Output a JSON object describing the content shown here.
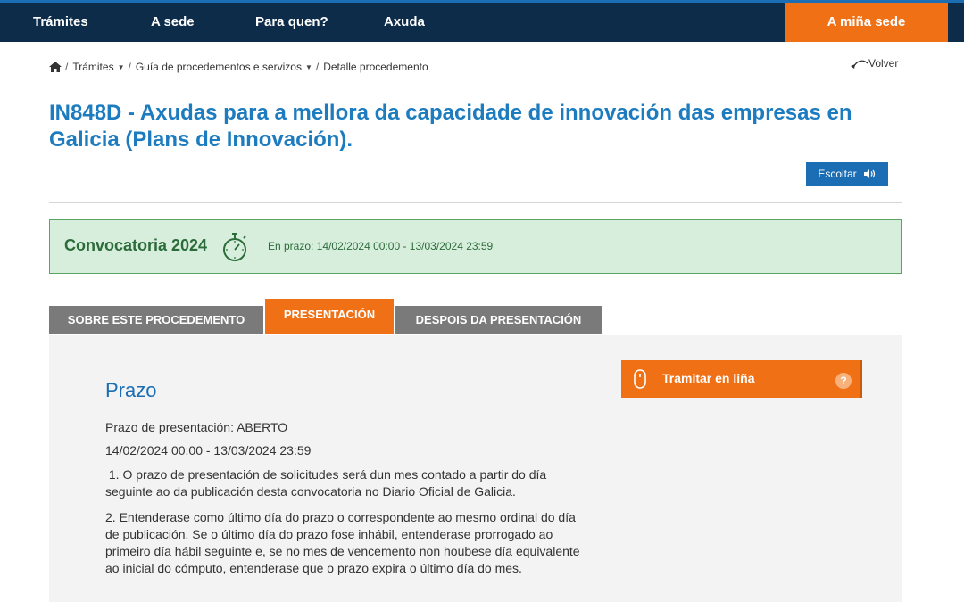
{
  "nav": {
    "items": [
      "Trámites",
      "A sede",
      "Para quen?",
      "Axuda"
    ],
    "my_site": "A miña sede"
  },
  "breadcrumb": {
    "items": [
      "Trámites",
      "Guía de procedementos e servizos",
      "Detalle procedemento"
    ],
    "back": "Volver"
  },
  "title": "IN848D - Axudas para a mellora da capacidade de innovación das empresas en Galicia (Plans de Innovación).",
  "listen_button": "Escoitar",
  "convocatoria": {
    "title": "Convocatoria 2024",
    "status_label": "En prazo:",
    "range": "14/02/2024 00:00 - 13/03/2024 23:59"
  },
  "tabs": [
    "SOBRE ESTE PROCEDEMENTO",
    "PRESENTACIÓN",
    "DESPOIS DA PRESENTACIÓN"
  ],
  "active_tab": "PRESENTACIÓN",
  "content": {
    "heading": "Prazo",
    "deadline_status": "Prazo de presentación: ABERTO",
    "deadline_range": "14/02/2024 00:00 - 13/03/2024 23:59",
    "para1_line1": " 1. O prazo de presentación de solicitudes será dun mes contado a partir do día",
    "para1_line2": "seguinte ao da publicación desta convocatoria no Diario Oficial de Galicia.",
    "para2_line1": "2. Entenderase como último día do prazo o correspondente ao mesmo ordinal do día",
    "para2_line2": "de publicación. Se o último día do prazo fose inhábil, entenderase prorrogado ao",
    "para2_line3": "primeiro día hábil seguinte e, se no mes de vencemento non houbese día equivalente",
    "para2_line4": "ao inicial do cómputo, entenderase que o prazo expira o último día do mes."
  },
  "tramitar": {
    "label": "Tramitar en liña",
    "help": "?"
  },
  "colors": {
    "navbar": "#0c2c4a",
    "accent_orange": "#f07016",
    "title_blue": "#1c7cbf",
    "conv_bg": "#d6eedb",
    "conv_border": "#5aa563"
  },
  "icons": [
    "home-icon",
    "chevron-down-icon",
    "back-arrow-icon",
    "speaker-icon",
    "stopwatch-icon",
    "mouse-icon",
    "help-icon"
  ]
}
